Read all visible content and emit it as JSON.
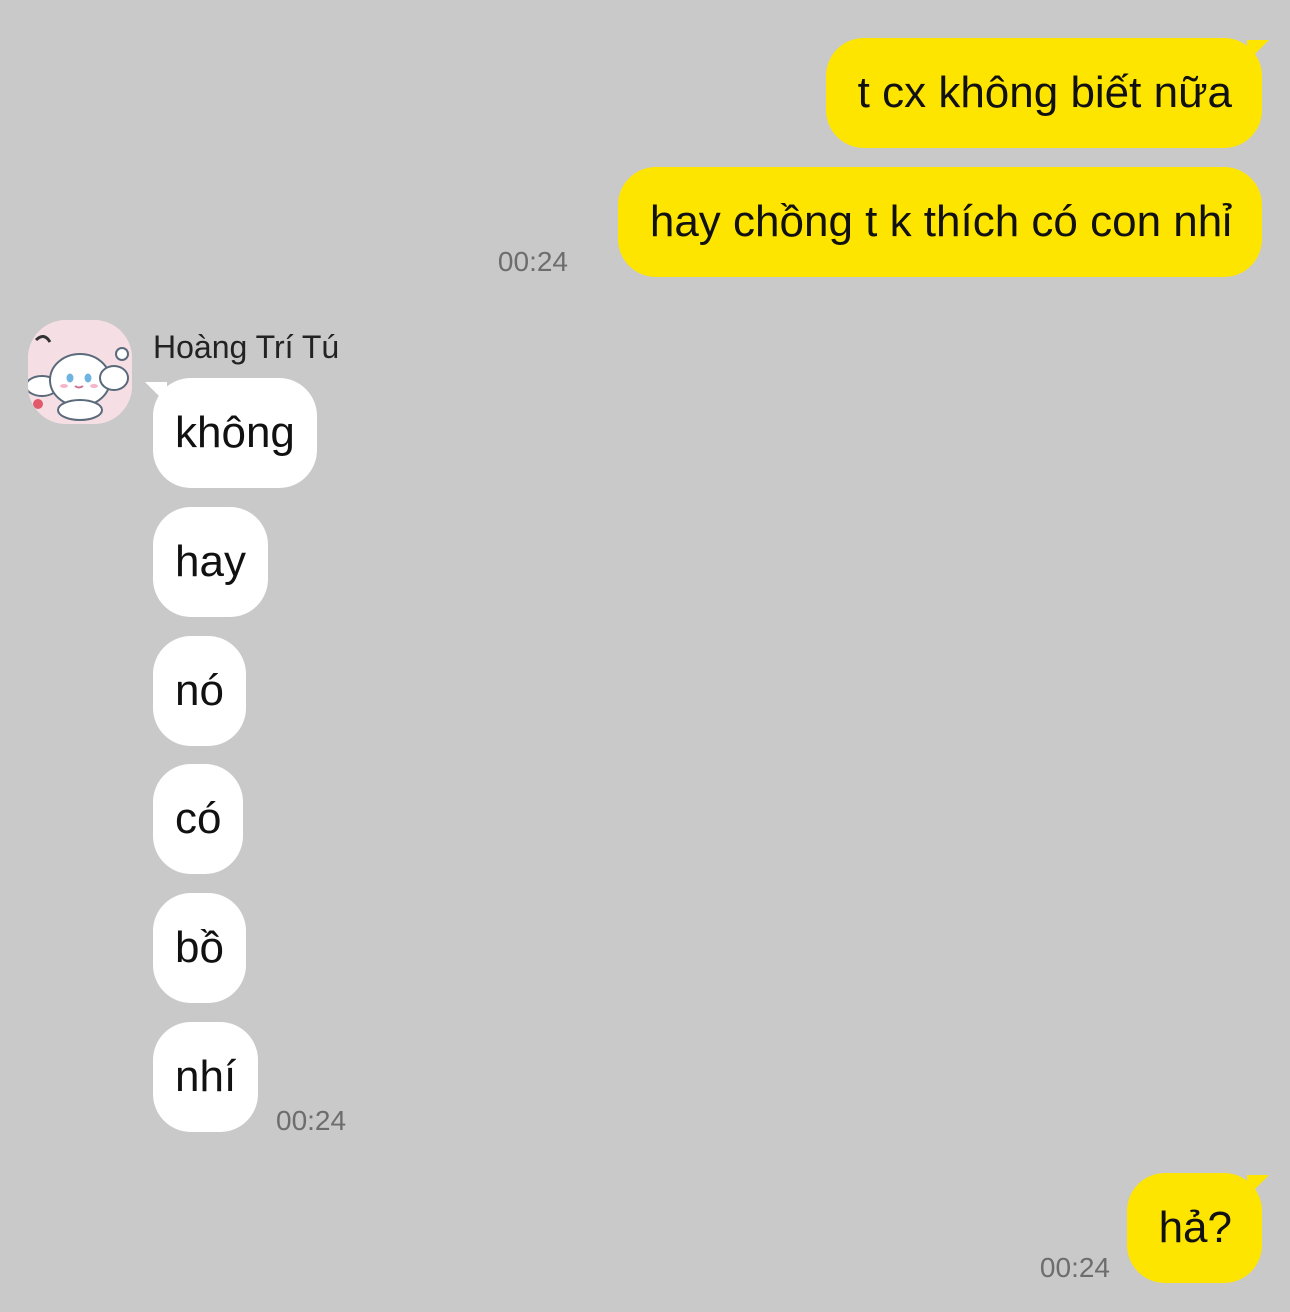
{
  "chat": {
    "background_color": "#c9c9c9",
    "outgoing_bubble_color": "#fee500",
    "incoming_bubble_color": "#ffffff",
    "outgoing": [
      {
        "text": "t cx không biết nữa"
      },
      {
        "text": "hay chồng t k thích có con nhỉ",
        "time": "00:24"
      }
    ],
    "incoming_group": {
      "sender_name": "Hoàng Trí Tú",
      "avatar_icon": "cinnamoroll-avatar-icon",
      "messages": [
        {
          "text": "không"
        },
        {
          "text": "hay"
        },
        {
          "text": "nó"
        },
        {
          "text": "có"
        },
        {
          "text": "bồ"
        },
        {
          "text": "nhí"
        }
      ],
      "time": "00:24"
    },
    "last_outgoing": {
      "text": "hả?",
      "time": "00:24"
    }
  }
}
